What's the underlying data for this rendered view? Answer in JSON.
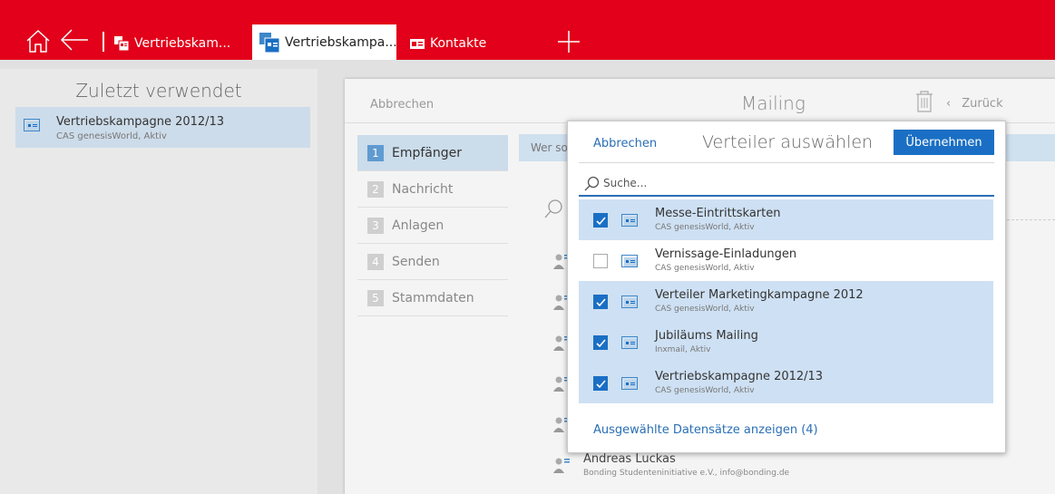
{
  "colors": {
    "brand_red": "#e2001a",
    "accent_blue": "#1a6fc4",
    "selection_blue": "#cee0f3"
  },
  "tabs": [
    {
      "label": "Vertriebskam...",
      "icon": "campaign-icon"
    },
    {
      "label": "Vertriebskampa...",
      "icon": "campaign-icon",
      "active": true
    },
    {
      "label": "Kontakte",
      "icon": "contact-card-icon"
    }
  ],
  "recent": {
    "title": "Zuletzt verwendet",
    "items": [
      {
        "name": "Vertriebskampagne 2012/13",
        "sub": "CAS genesisWorld, Aktiv"
      }
    ]
  },
  "mailing": {
    "cancel": "Abbrechen",
    "title": "Mailing",
    "back": "Zurück",
    "steps": [
      {
        "num": "1",
        "label": "Empfänger",
        "active": true
      },
      {
        "num": "2",
        "label": "Nachricht"
      },
      {
        "num": "3",
        "label": "Anlagen"
      },
      {
        "num": "4",
        "label": "Senden"
      },
      {
        "num": "5",
        "label": "Stammdaten"
      }
    ],
    "banner": "Wer so",
    "contact": {
      "name": "Andreas Luckas",
      "sub": "Bonding Studenteninitiative e.V., info@bonding.de"
    }
  },
  "popup": {
    "cancel": "Abbrechen",
    "title": "Verteiler auswählen",
    "accept": "Übernehmen",
    "search_placeholder": "Suche...",
    "items": [
      {
        "name": "Messe-Eintrittskarten",
        "sub": "CAS genesisWorld, Aktiv",
        "checked": true
      },
      {
        "name": "Vernissage-Einladungen",
        "sub": "CAS genesisWorld, Aktiv",
        "checked": false
      },
      {
        "name": "Verteiler Marketingkampagne 2012",
        "sub": "CAS genesisWorld, Aktiv",
        "checked": true
      },
      {
        "name": "Jubiläums Mailing",
        "sub": "Inxmail, Aktiv",
        "checked": true
      },
      {
        "name": "Vertriebskampagne 2012/13",
        "sub": "CAS genesisWorld, Aktiv",
        "checked": true
      }
    ],
    "show_selected": "Ausgewählte Datensätze anzeigen (4)"
  }
}
